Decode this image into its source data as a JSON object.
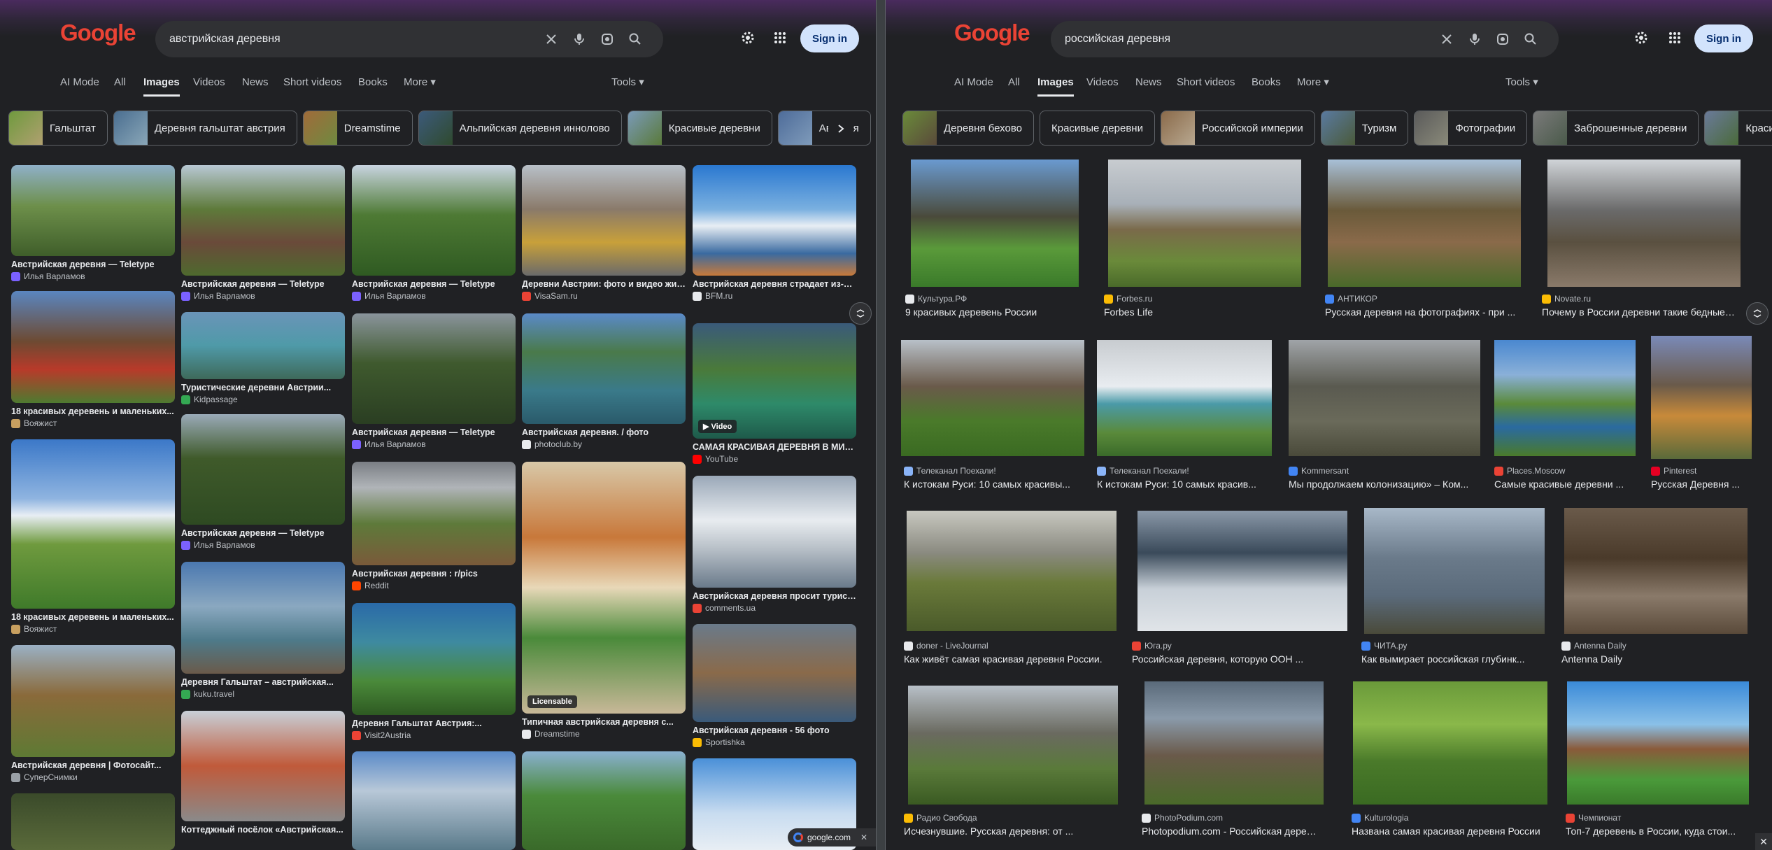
{
  "left": {
    "logo": "Google",
    "query": "австрийская деревня",
    "signin": "Sign in",
    "tabs": [
      "AI Mode",
      "All",
      "Images",
      "Videos",
      "News",
      "Short videos",
      "Books",
      "More",
      "Tools"
    ],
    "chips": [
      "Гальштат",
      "Деревня гальштат австрия",
      "Dreamstime",
      "Альпийская деревня иннолово",
      "Красивые деревни",
      "Австрия"
    ],
    "results": [
      {
        "title": "Австрийская деревня — Teletype",
        "source": "Илья Варламов"
      },
      {
        "title": "18 красивых деревень и маленьких...",
        "source": "Вояжист"
      },
      {
        "title": "18 красивых деревень и маленьких...",
        "source": "Вояжист"
      },
      {
        "title": "Австрийская деревня | Фотосайт...",
        "source": "СуперСнимки"
      },
      {
        "title": "Австрийская деревня — Teletype",
        "source": "Илья Варламов"
      },
      {
        "title": "Туристические деревни Австрии...",
        "source": "Kidpassage"
      },
      {
        "title": "Австрийская деревня — Teletype",
        "source": "Илья Варламов"
      },
      {
        "title": "Деревня Гальштат – австрийская...",
        "source": "kuku.travel"
      },
      {
        "title": "Коттеджный посёлок «Австрийская...",
        "source": ""
      },
      {
        "title": "Австрийская деревня — Teletype",
        "source": "Илья Варламов"
      },
      {
        "title": "Австрийская деревня — Teletype",
        "source": "Илья Варламов"
      },
      {
        "title": "Австрийская деревня : r/pics",
        "source": "Reddit"
      },
      {
        "title": "Деревня Гальштат Австрия:...",
        "source": "Visit2Austria"
      },
      {
        "title": "Деревни Австрии: фото и видео жизни...",
        "source": "VisaSam.ru"
      },
      {
        "title": "Австрийская деревня. / фото",
        "source": "photoclub.by"
      },
      {
        "title": "Типичная австрийская деревня с...",
        "source": "Dreamstime"
      },
      {
        "title": "Австрийская деревня страдает из-за...",
        "source": "BFM.ru"
      },
      {
        "title": "САМАЯ КРАСИВАЯ ДЕРЕВНЯ В МИР...",
        "source": "YouTube"
      },
      {
        "title": "Австрийская деревня просит туристов...",
        "source": "comments.ua"
      },
      {
        "title": "Австрийская деревня - 56 фото",
        "source": "Sportishka"
      }
    ],
    "badges": {
      "video": "▶ Video",
      "licensable": "Licensable"
    },
    "google_pill": "google.com"
  },
  "right": {
    "logo": "Google",
    "query": "российская деревня",
    "signin": "Sign in",
    "tabs": [
      "AI Mode",
      "All",
      "Images",
      "Videos",
      "News",
      "Short videos",
      "Books",
      "More",
      "Tools"
    ],
    "chips": [
      "Деревня бехово",
      "Красивые деревни",
      "Российской империи",
      "Туризм",
      "Фотографии",
      "Заброшенные деревни",
      "Красив"
    ],
    "results": [
      {
        "title": "9 красивых деревень России",
        "source": "Культура.РФ"
      },
      {
        "title": "Forbes Life",
        "source": "Forbes.ru"
      },
      {
        "title": "Русская деревня на фотографиях - при ...",
        "source": "АНТИКОР"
      },
      {
        "title": "Почему в России деревни такие бедные ...",
        "source": "Novate.ru"
      },
      {
        "title": "К истокам Руси: 10 самых красивы...",
        "source": "Телеканал Поехали!"
      },
      {
        "title": "К истокам Руси: 10 самых красив...",
        "source": "Телеканал Поехали!"
      },
      {
        "title": "Мы продолжаем колонизацию» – Ком...",
        "source": "Kommersant"
      },
      {
        "title": "Самые красивые деревни ...",
        "source": "Places.Moscow"
      },
      {
        "title": "Русская Деревня ...",
        "source": "Pinterest"
      },
      {
        "title": "Как живёт самая красивая деревня России.",
        "source": "doner - LiveJournal"
      },
      {
        "title": "Российская деревня, которую ООН ...",
        "source": "Юга.ру"
      },
      {
        "title": "Как вымирает российская глубинк...",
        "source": "ЧИТА.ру"
      },
      {
        "title": "Antenna Daily",
        "source": "Antenna Daily"
      },
      {
        "title": "Исчезнувшие. Русская деревня: от ...",
        "source": "Радио Свобода"
      },
      {
        "title": "Photopodium.com - Российская деревня.",
        "source": "PhotoPodium.com"
      },
      {
        "title": "Названа самая красивая деревня России",
        "source": "Kulturologia"
      },
      {
        "title": "Топ-7 деревень в России, куда стои...",
        "source": "Чемпионат"
      }
    ]
  },
  "colors": {
    "background": "#202124",
    "surface": "#303134",
    "accent": "#d2e3fc",
    "text": "#e8eaed",
    "muted": "#bdc1c6"
  },
  "icons": [
    "clear-icon",
    "mic-icon",
    "lens-icon",
    "search-icon",
    "gear-icon",
    "apps-icon",
    "chevron-right-icon",
    "lens-float-icon",
    "close-icon"
  ]
}
